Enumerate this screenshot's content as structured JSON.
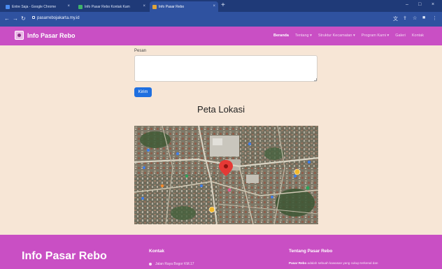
{
  "browser": {
    "tabs": [
      {
        "title": "Entre Saja - Google Chrome",
        "active": false
      },
      {
        "title": "Info Pasar Rebo Kontak Kam",
        "active": false
      },
      {
        "title": "Info Pasar Rebo",
        "active": true
      }
    ],
    "new_tab": "+",
    "url": "pasarrebojakarta.my.id",
    "window_controls": {
      "minimize": "–",
      "maximize": "□",
      "close": "×"
    }
  },
  "site": {
    "brand": "Info Pasar Rebo",
    "nav": [
      {
        "label": "Beranda",
        "active": true
      },
      {
        "label": "Tentang ▾",
        "active": false
      },
      {
        "label": "Struktur Kecamatan ▾",
        "active": false
      },
      {
        "label": "Program Kami ▾",
        "active": false
      },
      {
        "label": "Galeri",
        "active": false
      },
      {
        "label": "Kontak",
        "active": false
      }
    ]
  },
  "form": {
    "pesan_label": "Pesan",
    "pesan_value": "",
    "submit_label": "Kirim"
  },
  "map_section": {
    "title": "Peta Lokasi"
  },
  "footer": {
    "brand": "Info Pasar Rebo",
    "kontak_heading": "Kontak",
    "address": "Jalan Raya Bogor KM.17",
    "tentang_heading": "Tentang Pasar Rebo",
    "about_bold": "Pasar Rebo",
    "about_text": " adalah sebuah kawasan yang cukup terkenal dan"
  },
  "colors": {
    "brand_magenta": "#c94fc4",
    "page_background": "#f7e6d6",
    "button_blue": "#1f6fe0",
    "browser_blue": "#2f52a0"
  }
}
